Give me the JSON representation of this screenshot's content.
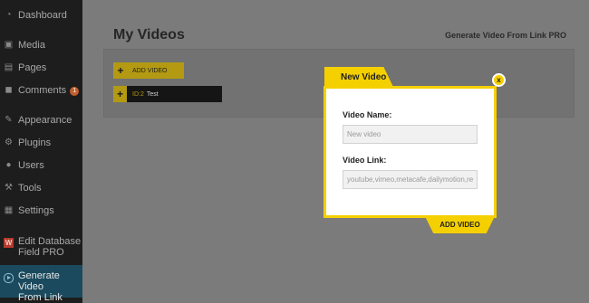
{
  "sidebar": {
    "items": [
      {
        "label": "Dashboard",
        "icon": "dashboard-icon",
        "glyph": "◔"
      },
      {
        "label": "Media",
        "icon": "media-icon",
        "glyph": "▣"
      },
      {
        "label": "Pages",
        "icon": "pages-icon",
        "glyph": "▤"
      },
      {
        "label": "Comments",
        "icon": "comments-icon",
        "glyph": "◼",
        "badge": "1"
      },
      {
        "label": "Appearance",
        "icon": "appearance-icon",
        "glyph": "✎"
      },
      {
        "label": "Plugins",
        "icon": "plugins-icon",
        "glyph": "⚙"
      },
      {
        "label": "Users",
        "icon": "users-icon",
        "glyph": "●"
      },
      {
        "label": "Tools",
        "icon": "tools-icon",
        "glyph": "⚒"
      },
      {
        "label": "Settings",
        "icon": "settings-icon",
        "glyph": "▦"
      },
      {
        "label_line1": "Edit Database",
        "label_line2": "Field PRO",
        "icon": "plugin-w-icon",
        "glyph": "W"
      },
      {
        "label_line1": "Generate Video",
        "label_line2": "From Link PRO",
        "icon": "play-icon",
        "active": true
      }
    ]
  },
  "main": {
    "title": "My Videos",
    "plugin_title": "Generate Video From Link PRO",
    "add_button": {
      "plus": "+",
      "label": "ADD VIDEO"
    },
    "videos": [
      {
        "plus": "+",
        "id": "ID:2",
        "title": "Test"
      }
    ]
  },
  "modal": {
    "tab_label": "New Video",
    "close_label": "x",
    "name_label": "Video Name:",
    "name_placeholder": "New video",
    "link_label": "Video Link:",
    "link_placeholder": "youtube,vimeo,metacafe,dailymotion,re",
    "submit_label": "ADD VIDEO"
  },
  "colors": {
    "accent_yellow": "#f5d000",
    "sidebar_bg": "#1d1d1d",
    "sidebar_active": "#1b4a5e",
    "badge": "#c25f2e"
  }
}
